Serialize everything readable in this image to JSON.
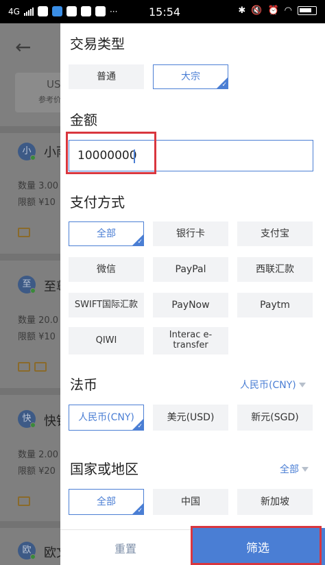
{
  "status_bar": {
    "network": "4G",
    "time": "15:54"
  },
  "background": {
    "tab_label": "US",
    "tab_sub": "参考价",
    "rows": [
      {
        "avatar": "小",
        "name": "小雨",
        "line1": "数量 3.00",
        "line2": "限额 ¥10"
      },
      {
        "avatar": "至",
        "name": "至尊",
        "line1": "数量 20.0",
        "line2": "限额 ¥10"
      },
      {
        "avatar": "快",
        "name": "快钱",
        "line1": "数量 2.00",
        "line2": "限额 ¥20"
      },
      {
        "avatar": "欧",
        "name": "欧文",
        "line1": "",
        "line2": ""
      }
    ]
  },
  "filter": {
    "trade_type": {
      "title": "交易类型",
      "options": [
        "普通",
        "大宗"
      ],
      "selected": "大宗"
    },
    "amount": {
      "title": "金额",
      "value": "10000000"
    },
    "payment": {
      "title": "支付方式",
      "options": [
        "全部",
        "银行卡",
        "支付宝",
        "微信",
        "PayPal",
        "西联汇款",
        "SWIFT国际汇款",
        "PayNow",
        "Paytm",
        "QIWI",
        "Interac e-transfer"
      ],
      "selected": "全部"
    },
    "fiat": {
      "title": "法币",
      "dropdown": "人民币(CNY)",
      "options": [
        "人民币(CNY)",
        "美元(USD)",
        "新元(SGD)"
      ],
      "selected": "人民币(CNY)"
    },
    "region": {
      "title": "国家或地区",
      "dropdown": "全部",
      "options": [
        "全部",
        "中国",
        "新加坡"
      ],
      "selected": "全部"
    },
    "buttons": {
      "reset": "重置",
      "filter": "筛选"
    }
  },
  "colors": {
    "accent": "#4a7ed4",
    "highlight": "#d9363e"
  }
}
